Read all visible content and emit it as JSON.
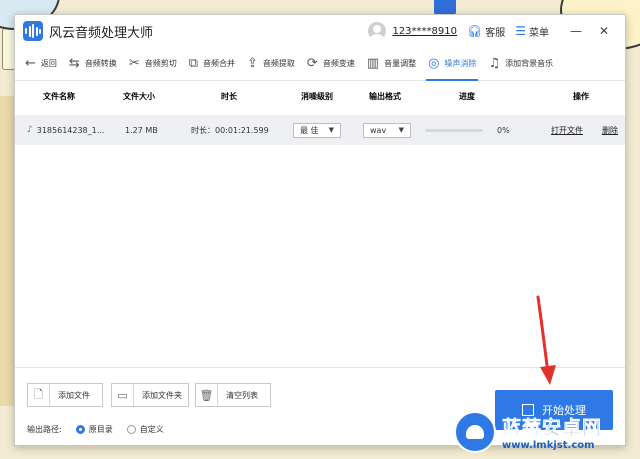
{
  "app": {
    "title": "风云音频处理大师"
  },
  "titlebar": {
    "user": "123****8910",
    "service": "客服",
    "menu": "菜单",
    "minimize": "—",
    "close": "✕"
  },
  "toolbar": {
    "back": "返回",
    "tools": [
      {
        "label": "音频转换",
        "icon": "convert-icon",
        "glyph": "⇆"
      },
      {
        "label": "音频剪切",
        "icon": "scissors-icon",
        "glyph": "✂"
      },
      {
        "label": "音频合并",
        "icon": "merge-icon",
        "glyph": "⧉"
      },
      {
        "label": "音频提取",
        "icon": "extract-icon",
        "glyph": "⇪"
      },
      {
        "label": "音频变速",
        "icon": "speed-icon",
        "glyph": "⟳"
      },
      {
        "label": "音量调整",
        "icon": "volume-icon",
        "glyph": "▥"
      },
      {
        "label": "噪声消除",
        "icon": "noise-icon",
        "glyph": "◎"
      },
      {
        "label": "添加背景音乐",
        "icon": "music-icon",
        "glyph": "♫"
      }
    ],
    "active_index": 6
  },
  "table": {
    "headers": {
      "name": "文件名称",
      "size": "文件大小",
      "duration": "时长",
      "level": "消噪级别",
      "format": "输出格式",
      "progress": "进度",
      "action": "操作"
    },
    "rows": [
      {
        "name": "3185614238_1...",
        "size": "1.27 MB",
        "duration": "时长：00:01:21.599",
        "level": "最 佳",
        "format": "wav",
        "progress_text": "0%",
        "progress_value": 0,
        "open": "打开文件",
        "delete": "删除"
      }
    ]
  },
  "bottom": {
    "add_file": "添加文件",
    "add_folder": "添加文件夹",
    "clear": "清空列表",
    "output_label": "输出路径:",
    "opt_original": "原目录",
    "opt_custom": "自定义",
    "start": "开始处理"
  },
  "watermark": {
    "name": "蓝莓安卓网",
    "url": "www.lmkjst.com"
  },
  "colors": {
    "accent": "#2e79e6",
    "arrow": "#e2322d"
  }
}
